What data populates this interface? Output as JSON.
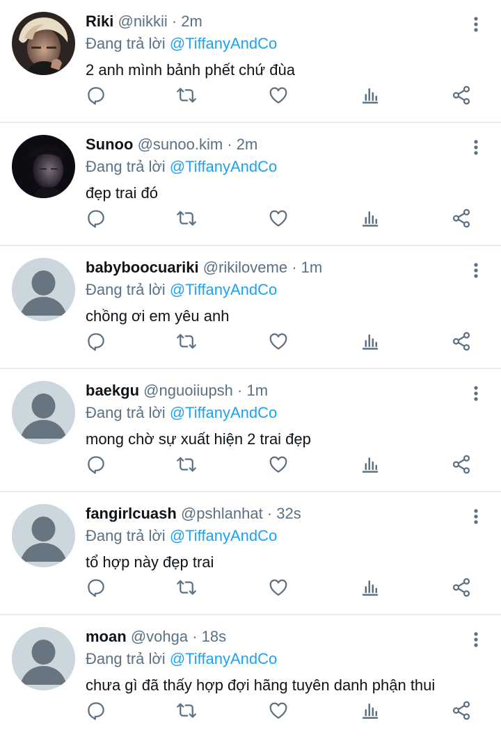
{
  "feed": {
    "reply_prefix": "Đang trả lời",
    "tweets": [
      {
        "name": "Riki",
        "handle": "@nikkii",
        "separator": "·",
        "time": "2m",
        "reply_to": "@TiffanyAndCo",
        "text": "2 anh mình bảnh phết chứ đùa",
        "avatar": "photo-blond-hair"
      },
      {
        "name": "Sunoo",
        "handle": "@sunoo.kim",
        "separator": "·",
        "time": "2m",
        "reply_to": "@TiffanyAndCo",
        "text": "đẹp trai đó",
        "avatar": "photo-dark-portrait"
      },
      {
        "name": "babyboocuariki",
        "handle": "@rikiloveme",
        "separator": "·",
        "time": "1m",
        "reply_to": "@TiffanyAndCo",
        "text": "chồng ơi em yêu anh",
        "avatar": "default-profile"
      },
      {
        "name": "baekgu",
        "handle": "@nguoiiupsh",
        "separator": "·",
        "time": "1m",
        "reply_to": "@TiffanyAndCo",
        "text": "mong chờ sự xuất hiện 2 trai đẹp",
        "avatar": "default-profile"
      },
      {
        "name": "fangirlcuash",
        "handle": "@pshlanhat",
        "separator": "·",
        "time": "32s",
        "reply_to": "@TiffanyAndCo",
        "text": "tổ hợp này đẹp trai",
        "avatar": "default-profile"
      },
      {
        "name": "moan",
        "handle": "@vohga",
        "separator": "·",
        "time": "18s",
        "reply_to": "@TiffanyAndCo",
        "text": "chưa gì đã thấy hợp đợi hãng tuyên danh phận thui",
        "avatar": "default-profile"
      }
    ]
  },
  "icons": {
    "reply": "reply-icon",
    "retweet": "retweet-icon",
    "like": "like-icon",
    "stats": "stats-icon",
    "share": "share-icon",
    "more": "more-icon"
  },
  "colors": {
    "text": "#0f1419",
    "secondary": "#5b7083",
    "accent": "#1da1f2",
    "divider": "#e6ecf0",
    "default_avatar_bg": "#ccd6dd",
    "default_avatar_fg": "#66757f"
  }
}
